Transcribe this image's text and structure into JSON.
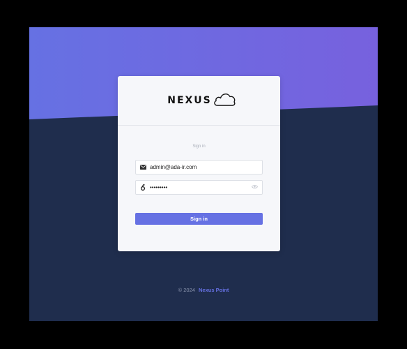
{
  "colors": {
    "outer_background": "#000000",
    "screen_background": "#1f2d4d",
    "gradient_start": "#6671e3",
    "gradient_end": "#7761de",
    "accent": "#6671e3",
    "card_background": "#f6f7fa"
  },
  "logo": {
    "text": "NEXUS",
    "icon": "cloud-icon"
  },
  "login": {
    "subtitle": "Sign in",
    "email": {
      "icon": "envelope-icon",
      "value": "admin@ada-ir.com"
    },
    "password": {
      "icon": "key-icon",
      "value": "•••••••••",
      "toggle_icon": "eye-icon"
    },
    "submit_label": "Sign in"
  },
  "footer": {
    "copyright": "© 2024",
    "link_text": "Nexus Point"
  }
}
